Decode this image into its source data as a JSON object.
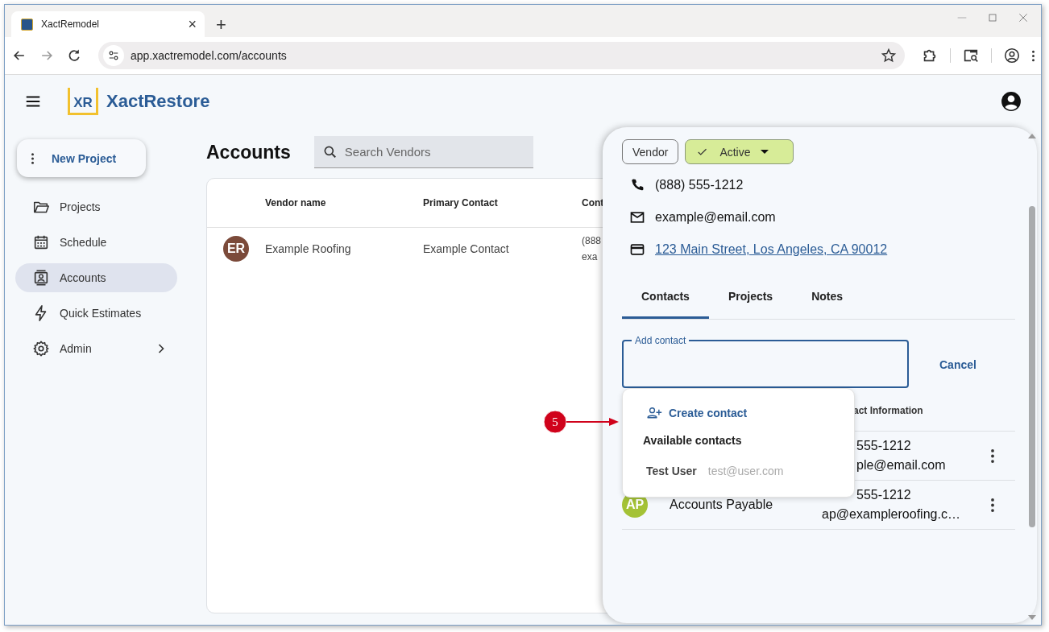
{
  "browser": {
    "tab": {
      "title": "XactRemodel",
      "close": "×"
    },
    "new_tab": "+",
    "url": "app.xactremodel.com/accounts"
  },
  "app": {
    "logo": "XR",
    "name": "XactRestore"
  },
  "sidebar": {
    "new_project": "New Project",
    "items": [
      {
        "label": "Projects",
        "selected": false,
        "has_submenu": false
      },
      {
        "label": "Schedule",
        "selected": false,
        "has_submenu": false
      },
      {
        "label": "Accounts",
        "selected": true,
        "has_submenu": false
      },
      {
        "label": "Quick Estimates",
        "selected": false,
        "has_submenu": false
      },
      {
        "label": "Admin",
        "selected": false,
        "has_submenu": true
      }
    ]
  },
  "accounts": {
    "title": "Accounts",
    "search": {
      "placeholder": "Search Vendors"
    },
    "table": {
      "columns": [
        "Vendor name",
        "Primary Contact",
        "Cont"
      ],
      "rows": [
        {
          "initials": "ER",
          "color": "#7b4a3a",
          "cells": [
            "Example Roofing",
            "Example Contact"
          ],
          "contact_lines": [
            "(888",
            "exa"
          ]
        }
      ]
    }
  },
  "vendor_panel": {
    "type_chip": "Vendor",
    "status_chip": {
      "label": "Active",
      "checked": true
    },
    "phone": "(888) 555-1212",
    "email": "example@email.com",
    "address": "123 Main Street, Los Angeles, CA 90012",
    "tabs": [
      {
        "label": "Contacts",
        "selected": true
      },
      {
        "label": "Projects",
        "selected": false
      },
      {
        "label": "Notes",
        "selected": false
      }
    ],
    "add_contact": {
      "label": "Add contact"
    },
    "cancel": "Cancel",
    "contacts": {
      "column_header": "act Information",
      "rows": [
        {
          "info": [
            "555-1212",
            "ple@email.com"
          ]
        },
        {
          "initials": "AP",
          "color": "#a4c236",
          "name": "Accounts Payable",
          "info": [
            "555-1212",
            "ap@exampleroofing.c…"
          ]
        }
      ]
    },
    "menu": {
      "create": "Create contact",
      "section": "Available contacts",
      "options": [
        {
          "name": "Test User",
          "email": "test@user.com"
        }
      ]
    }
  },
  "callout": {
    "number": "5"
  }
}
